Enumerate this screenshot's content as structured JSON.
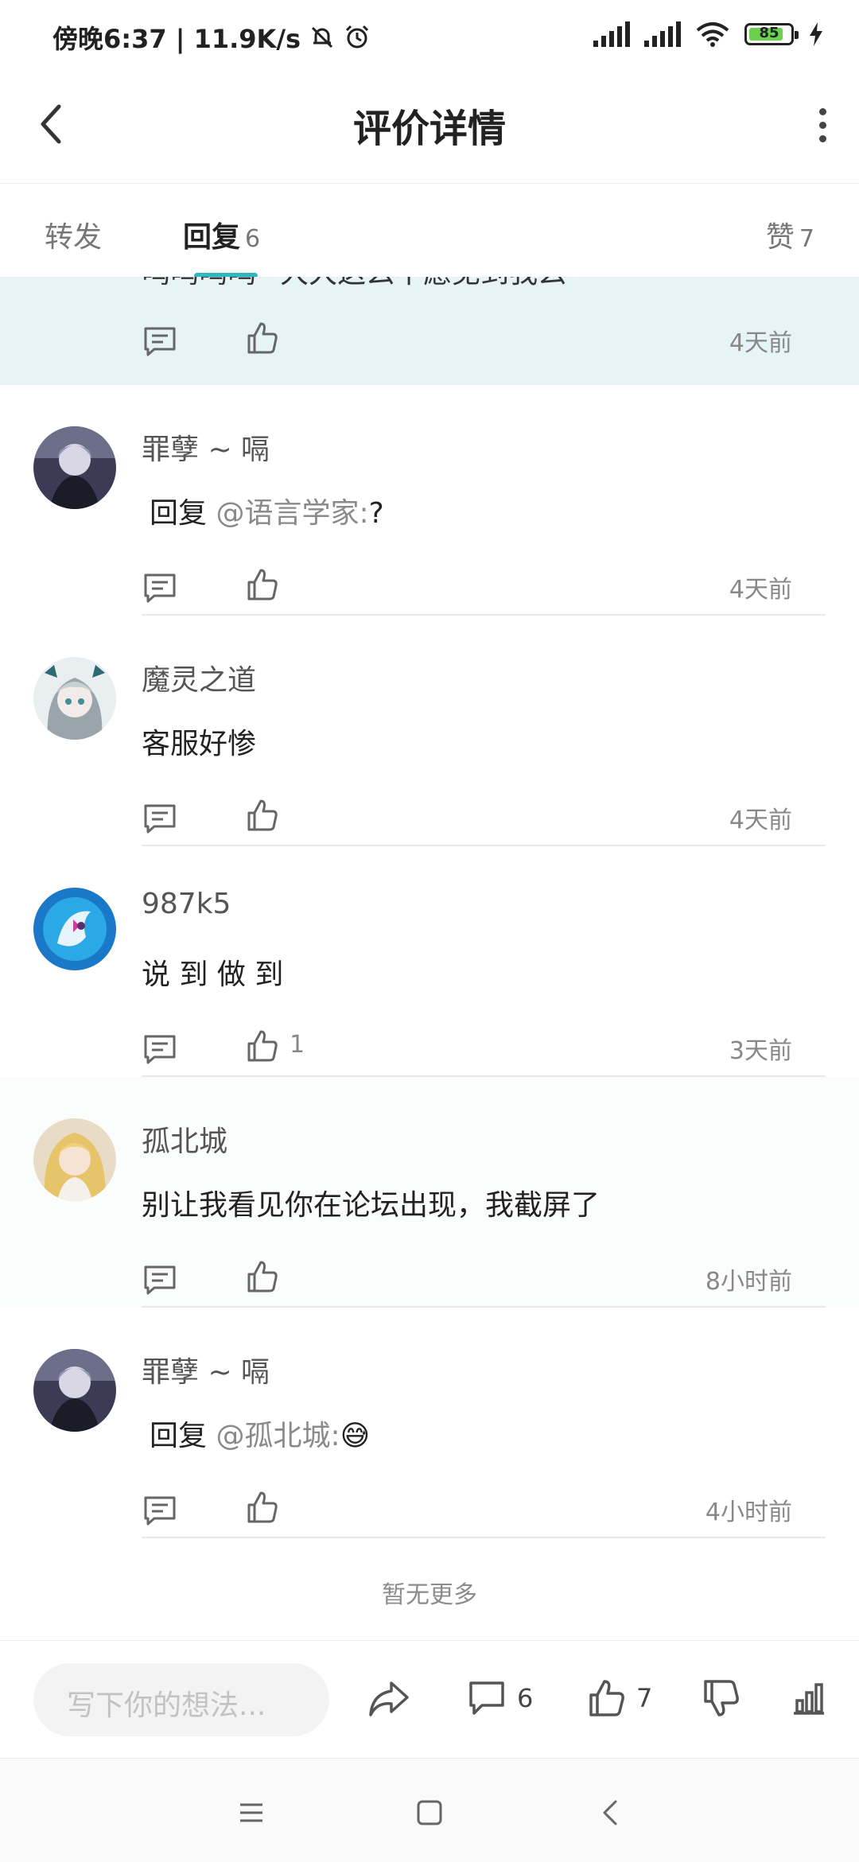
{
  "status_bar": {
    "time_speed": "傍晚6:37 | 11.9K/s",
    "battery": "85"
  },
  "header": {
    "title": "评价详情"
  },
  "tabs": [
    {
      "label": "转发",
      "count": ""
    },
    {
      "label": "回复",
      "count": "6"
    },
    {
      "label": "赞",
      "count": "7"
    }
  ],
  "highlighted_reply": {
    "text": "呜呜呜呜~大大这么不愿见到我么~",
    "time": "4天前"
  },
  "replies": [
    {
      "user": "罪孽 ~ 嗝",
      "prefix": "回复",
      "mention": "@语言学家:",
      "text": "?",
      "likes": "",
      "time": "4天前"
    },
    {
      "user": "魔灵之道",
      "prefix": "",
      "mention": "",
      "text": "客服好惨",
      "likes": "",
      "time": "4天前"
    },
    {
      "user": "987k5",
      "prefix": "",
      "mention": "",
      "text": "说 到 做 到",
      "likes": "1",
      "time": "3天前"
    },
    {
      "user": "孤北城",
      "prefix": "",
      "mention": "",
      "text": "别让我看见你在论坛出现，我截屏了",
      "likes": "",
      "time": "8小时前"
    },
    {
      "user": "罪孽 ~ 嗝",
      "prefix": "回复",
      "mention": "@孤北城:",
      "text": "😅",
      "likes": "",
      "time": "4小时前"
    }
  ],
  "no_more": "暂无更多",
  "action_bar": {
    "input_placeholder": "写下你的想法...",
    "comment_count": "6",
    "like_count": "7"
  },
  "colors": {
    "accent": "#2fb7c2",
    "highlight_bg": "#e6f4f7"
  }
}
